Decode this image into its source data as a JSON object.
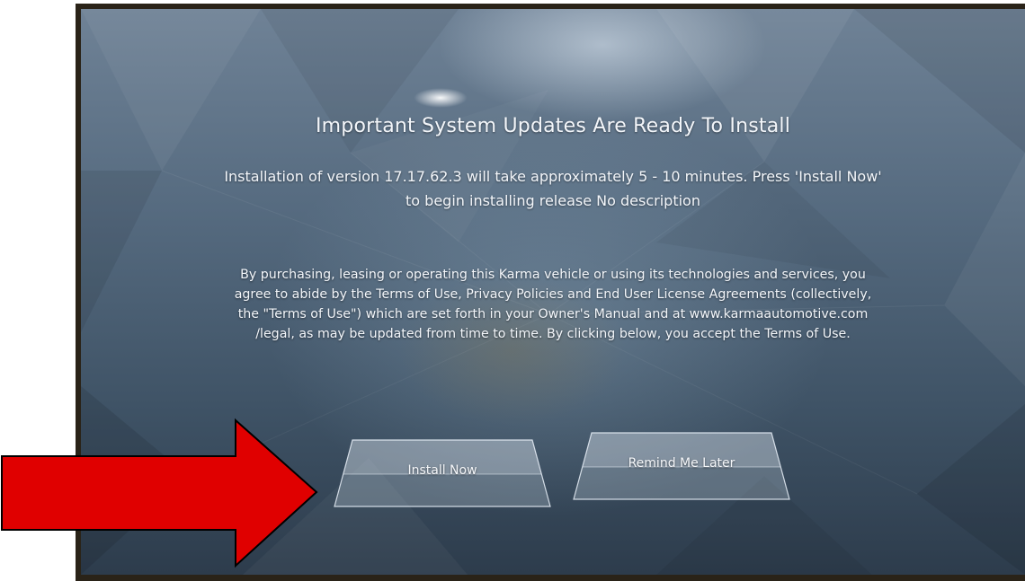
{
  "dialog": {
    "title": "Important System Updates Are Ready To Install",
    "subtitle_line1": "Installation of version 17.17.62.3 will take approximately 5 - 10 minutes. Press 'Install Now'",
    "subtitle_line2": "to begin installing release No description",
    "legal_line1": "By purchasing, leasing or operating this Karma vehicle or using its technologies and services, you",
    "legal_line2": "agree to abide by the Terms of Use, Privacy Policies and End User License Agreements (collectively,",
    "legal_line3": "the \"Terms of Use\") which are set forth in your Owner's Manual and at www.karmaautomotive.com",
    "legal_line4": "/legal, as may be updated from time to time.  By clicking below, you accept the Terms of Use."
  },
  "buttons": {
    "install_now": "Install Now",
    "remind_me_later": "Remind Me Later"
  },
  "annotation": {
    "arrow_color": "#e00000",
    "arrow_icon": "arrow-right-icon"
  }
}
